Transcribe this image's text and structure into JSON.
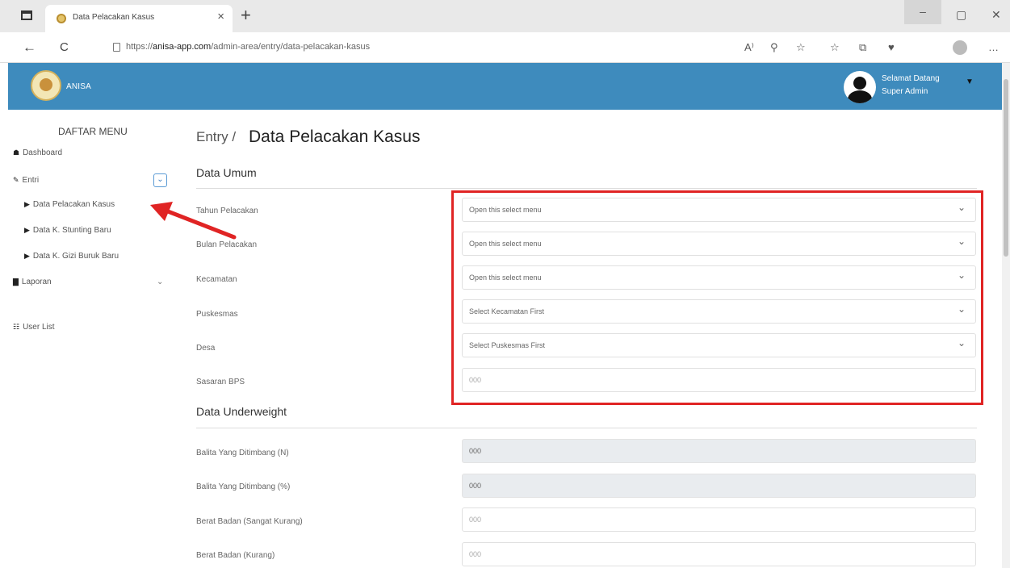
{
  "browser": {
    "tab_title": "Data Pelacakan Kasus",
    "tab_close": "×",
    "new_tab": "+",
    "url_prefix": "https://",
    "url_host": "anisa-app.com",
    "url_path": "/admin-area/entry/data-pelacakan-kasus",
    "back": "←",
    "reload": "C",
    "min": "–",
    "restore": "▢",
    "close": "✕",
    "tools": [
      "A⁾",
      "⚲",
      "☆",
      "☆",
      "⧉",
      "♥",
      "…"
    ]
  },
  "header": {
    "brand": "ANISA",
    "greeting_line1": "Selamat Datang",
    "greeting_line2": "Super Admin",
    "caret": "▼"
  },
  "sidebar": {
    "title": "DAFTAR MENU",
    "items": [
      {
        "icon": "☗",
        "label": "Dashboard"
      },
      {
        "icon": "✎",
        "label": "Entri"
      },
      {
        "icon": "▶",
        "label": "Data Pelacakan Kasus"
      },
      {
        "icon": "▶",
        "label": "Data K. Stunting Baru"
      },
      {
        "icon": "▶",
        "label": "Data K. Gizi Buruk Baru"
      },
      {
        "icon": "▇",
        "label": "Laporan"
      },
      {
        "icon": "☷",
        "label": "User List"
      }
    ],
    "chevron": "⌄"
  },
  "main": {
    "breadcrumb": "Entry /",
    "title": "Data Pelacakan Kasus",
    "section_umum": "Data Umum",
    "section_underweight": "Data Underweight",
    "fields": [
      {
        "label": "Tahun Pelacakan",
        "value": "Open this select menu"
      },
      {
        "label": "Bulan Pelacakan",
        "value": "Open this select menu"
      },
      {
        "label": "Kecamatan",
        "value": "Open this select menu"
      },
      {
        "label": "Puskesmas",
        "value": "Select Kecamatan First"
      },
      {
        "label": "Desa",
        "value": "Select Puskesmas First"
      },
      {
        "label": "Sasaran BPS",
        "placeholder": "000"
      }
    ],
    "underweight_fields": [
      {
        "label": "Balita Yang Ditimbang (N)",
        "placeholder": "000"
      },
      {
        "label": "Balita Yang Ditimbang (%)",
        "placeholder": "000"
      },
      {
        "label": "Berat Badan (Sangat Kurang)",
        "placeholder": "000"
      },
      {
        "label": "Berat Badan (Kurang)",
        "placeholder": "000"
      }
    ]
  },
  "colors": {
    "header": "#3e8bbd",
    "highlight": "#e02424"
  }
}
